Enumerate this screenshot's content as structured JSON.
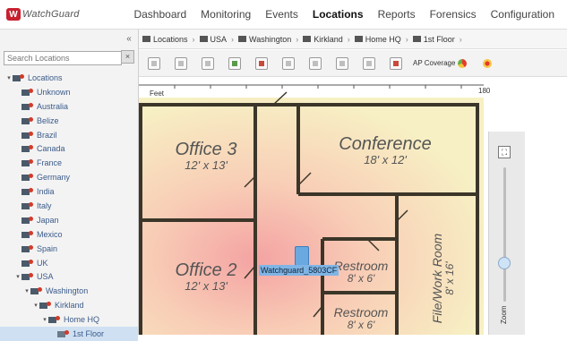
{
  "app": {
    "logo_text": "WatchGuard"
  },
  "nav": {
    "items": [
      "Dashboard",
      "Monitoring",
      "Events",
      "Locations",
      "Reports",
      "Forensics",
      "Configuration"
    ],
    "active": "Locations"
  },
  "left": {
    "collapse_glyph": "«",
    "search": {
      "placeholder": "Search Locations"
    },
    "tree": [
      {
        "label": "Locations",
        "depth": 0,
        "expanded": true
      },
      {
        "label": "Unknown",
        "depth": 1
      },
      {
        "label": "Australia",
        "depth": 1
      },
      {
        "label": "Belize",
        "depth": 1
      },
      {
        "label": "Brazil",
        "depth": 1
      },
      {
        "label": "Canada",
        "depth": 1
      },
      {
        "label": "France",
        "depth": 1
      },
      {
        "label": "Germany",
        "depth": 1
      },
      {
        "label": "India",
        "depth": 1
      },
      {
        "label": "Italy",
        "depth": 1
      },
      {
        "label": "Japan",
        "depth": 1
      },
      {
        "label": "Mexico",
        "depth": 1
      },
      {
        "label": "Spain",
        "depth": 1
      },
      {
        "label": "UK",
        "depth": 1
      },
      {
        "label": "USA",
        "depth": 1,
        "expanded": true
      },
      {
        "label": "Washington",
        "depth": 2,
        "expanded": true
      },
      {
        "label": "Kirkland",
        "depth": 3,
        "expanded": true
      },
      {
        "label": "Home HQ",
        "depth": 4,
        "expanded": true
      },
      {
        "label": "1st Floor",
        "depth": 5,
        "selected": true,
        "floor": true
      }
    ]
  },
  "breadcrumb": [
    "Locations",
    "USA",
    "Washington",
    "Kirkland",
    "Home HQ",
    "1st Floor"
  ],
  "toolbar": {
    "coverage_label": "AP Coverage"
  },
  "map": {
    "ruler_unit": "Feet",
    "ruler_end": "180",
    "rooms": [
      {
        "name": "Office 3",
        "size": "12' x 13'"
      },
      {
        "name": "Conference",
        "size": "18' x 12'"
      },
      {
        "name": "Office 2",
        "size": "12' x 13'"
      },
      {
        "name": "Restroom",
        "size": "8' x 6'"
      },
      {
        "name": "Restroom",
        "size": "8' x 6'"
      },
      {
        "name": "File/Work Room",
        "size": "8' x 16'"
      }
    ],
    "ap_label": "Watchguard_5803CF",
    "zoom_label": "Zoom"
  },
  "colors": {
    "accent": "#c8202f",
    "wall": "#3b3629",
    "selection": "#cfe0f2",
    "ap_label_bg": "#7fb5e6"
  }
}
